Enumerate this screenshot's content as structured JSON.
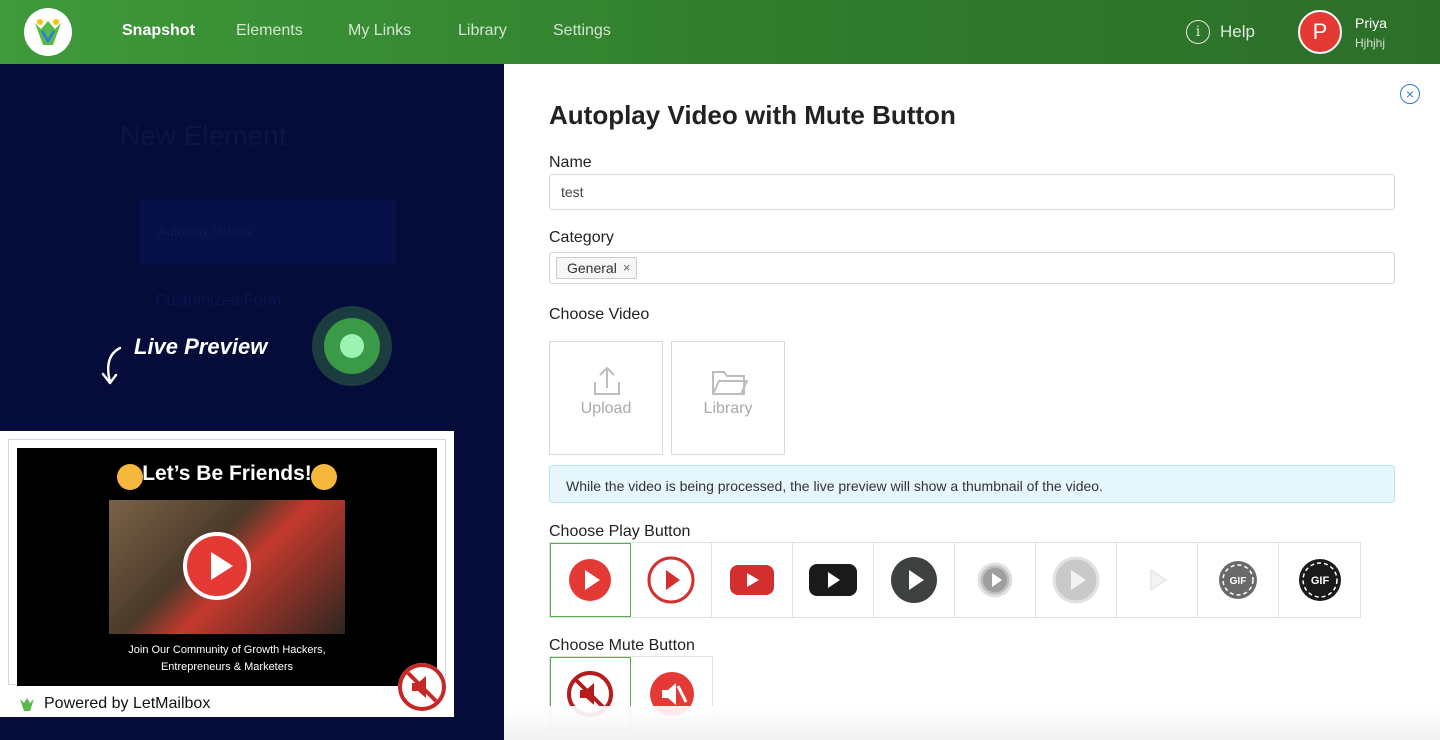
{
  "nav": {
    "items": [
      "Snapshot",
      "Elements",
      "My Links",
      "Library",
      "Settings"
    ],
    "active": "Snapshot",
    "help_label": "Help",
    "user": {
      "initial": "P",
      "name": "Priya",
      "subtitle": "Hjhjhj"
    }
  },
  "preview": {
    "background_title": "New Element",
    "background_item": "Autoplay Videos",
    "background_item2": "Customized Form",
    "live_preview_label": "Live Preview",
    "video_title": "Let’s Be Friends!",
    "video_caption_line1": "Join Our Community of Growth Hackers,",
    "video_caption_line2": "Entrepreneurs & Marketers",
    "powered_by": "Powered by LetMailbox"
  },
  "form": {
    "title": "Autoplay Video with Mute Button",
    "name_label": "Name",
    "name_value": "test",
    "category_label": "Category",
    "category_tag": "General",
    "choose_video_label": "Choose Video",
    "upload_label": "Upload",
    "library_label": "Library",
    "info_text": "While the video is being processed, the live preview will show a thumbnail of the video.",
    "play_button_label": "Choose Play Button",
    "mute_button_label": "Choose Mute Button",
    "play_buttons": [
      "red-circle-play",
      "red-outline-play",
      "youtube-red",
      "youtube-black",
      "dark-circle-play",
      "grey-ring-play",
      "light-grey-play",
      "faint-play",
      "gif-grey",
      "gif-black"
    ],
    "mute_buttons": [
      "red-outline-mute",
      "red-filled-mute"
    ]
  },
  "colors": {
    "brand_green": "#3f9a3a",
    "accent_red": "#e53935",
    "dark_panel": "#060c3a",
    "info_bg": "#e6f6fd"
  }
}
